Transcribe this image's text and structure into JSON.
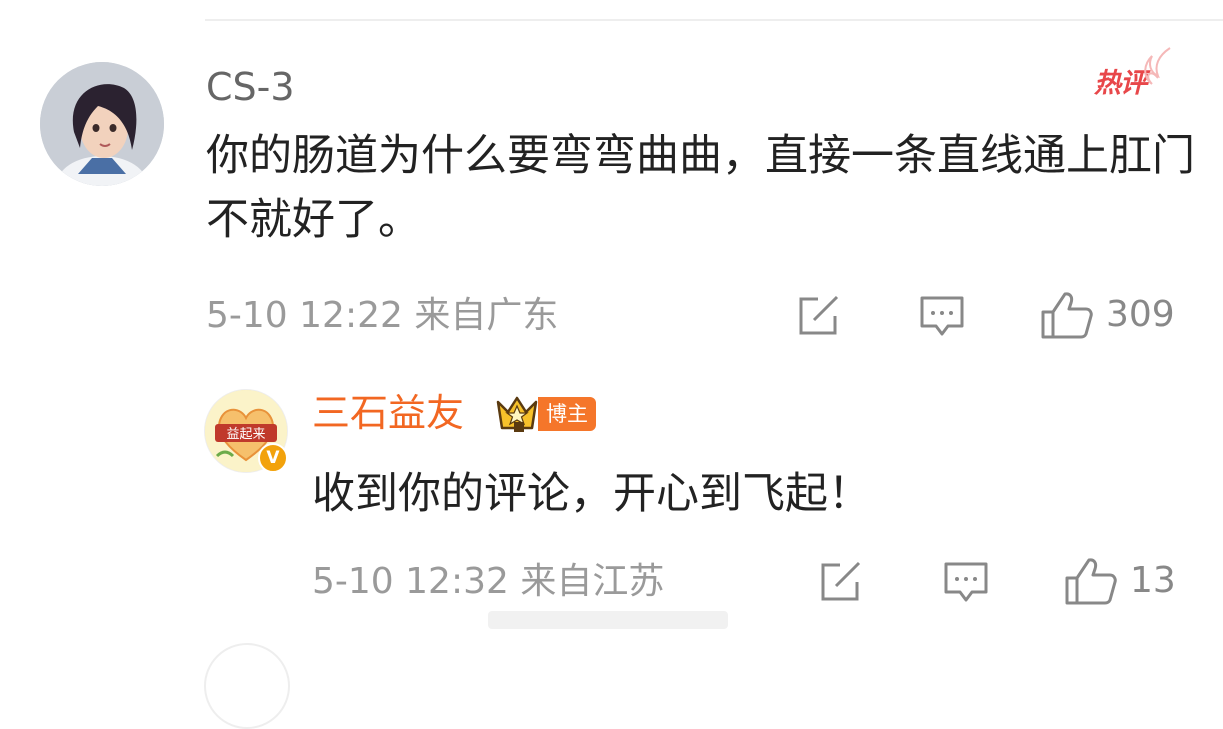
{
  "comment": {
    "username": "CS-3",
    "hot_badge": "热评",
    "text": "你的肠道为什么要弯弯曲曲，直接一条直线通上肛门不就好了。",
    "meta": "5-10 12:22 来自广东",
    "like_count": "309",
    "icons": [
      "share-icon",
      "comment-icon",
      "like-icon"
    ]
  },
  "reply": {
    "username": "三石益友",
    "avatar_text": "益起来",
    "verified_mark": "V",
    "blogger_badge": "博主",
    "text": "收到你的评论，开心到飞起！",
    "meta": "5-10 12:32 来自江苏",
    "like_count": "13",
    "icons": [
      "share-icon",
      "comment-icon",
      "like-icon"
    ]
  },
  "colors": {
    "username_reply": "#f26722",
    "hot_badge": "#e8474a",
    "blogger_badge_bg": "#f5762a",
    "meta_text": "#9a9a9a"
  }
}
